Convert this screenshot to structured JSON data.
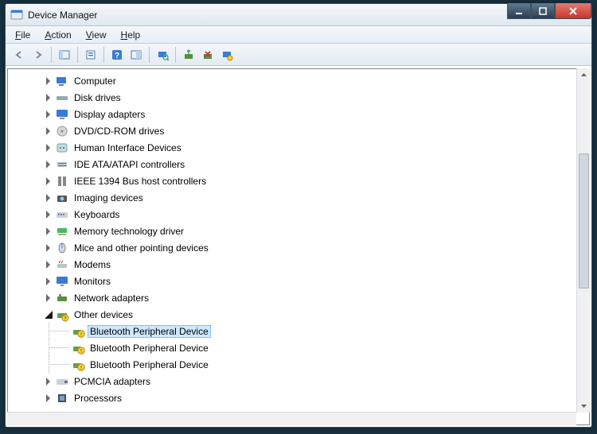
{
  "window": {
    "title": "Device Manager"
  },
  "menu": {
    "file": {
      "label": "File",
      "accel": "F"
    },
    "action": {
      "label": "Action",
      "accel": "A"
    },
    "view": {
      "label": "View",
      "accel": "V"
    },
    "help": {
      "label": "Help",
      "accel": "H"
    }
  },
  "toolbar": {
    "back": "Back",
    "forward": "Forward",
    "show_hide_tree": "Show/Hide Console Tree",
    "properties": "Properties",
    "help": "Help",
    "action_toolbar": "Action",
    "scan": "Scan for hardware changes",
    "update_driver": "Update Driver Software",
    "uninstall": "Uninstall",
    "disable": "Disable"
  },
  "tree": {
    "items": [
      {
        "label": "Computer",
        "icon": "computer-icon",
        "expanded": false
      },
      {
        "label": "Disk drives",
        "icon": "disk-icon",
        "expanded": false
      },
      {
        "label": "Display adapters",
        "icon": "display-icon",
        "expanded": false
      },
      {
        "label": "DVD/CD-ROM drives",
        "icon": "optical-icon",
        "expanded": false
      },
      {
        "label": "Human Interface Devices",
        "icon": "hid-icon",
        "expanded": false
      },
      {
        "label": "IDE ATA/ATAPI controllers",
        "icon": "ide-icon",
        "expanded": false
      },
      {
        "label": "IEEE 1394 Bus host controllers",
        "icon": "firewire-icon",
        "expanded": false
      },
      {
        "label": "Imaging devices",
        "icon": "imaging-icon",
        "expanded": false
      },
      {
        "label": "Keyboards",
        "icon": "keyboard-icon",
        "expanded": false
      },
      {
        "label": "Memory technology driver",
        "icon": "memory-icon",
        "expanded": false
      },
      {
        "label": "Mice and other pointing devices",
        "icon": "mouse-icon",
        "expanded": false
      },
      {
        "label": "Modems",
        "icon": "modem-icon",
        "expanded": false
      },
      {
        "label": "Monitors",
        "icon": "monitor-icon",
        "expanded": false
      },
      {
        "label": "Network adapters",
        "icon": "network-icon",
        "expanded": false
      },
      {
        "label": "Other devices",
        "icon": "other-icon",
        "expanded": true,
        "children": [
          {
            "label": "Bluetooth Peripheral Device",
            "icon": "unknown-device-icon",
            "selected": true
          },
          {
            "label": "Bluetooth Peripheral Device",
            "icon": "unknown-device-icon",
            "selected": false
          },
          {
            "label": "Bluetooth Peripheral Device",
            "icon": "unknown-device-icon",
            "selected": false
          }
        ]
      },
      {
        "label": "PCMCIA adapters",
        "icon": "pcmcia-icon",
        "expanded": false
      },
      {
        "label": "Processors",
        "icon": "processor-icon",
        "expanded": false
      }
    ]
  }
}
